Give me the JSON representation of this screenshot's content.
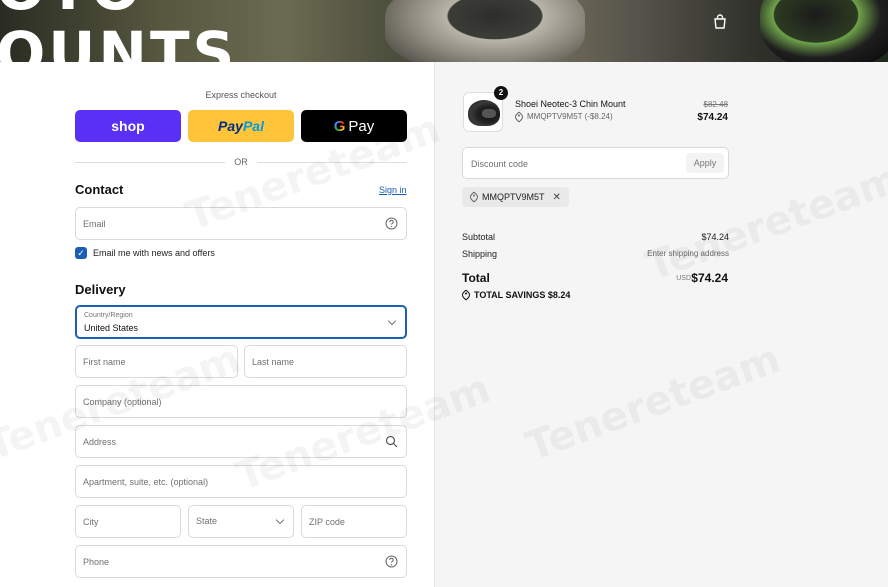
{
  "header": {
    "brand_line1": "OTO",
    "brand_line2": "OUNTS"
  },
  "express": {
    "label": "Express checkout",
    "shop_label": "shop",
    "paypal_part1": "Pay",
    "paypal_part2": "Pal",
    "gpay_g": "G",
    "gpay_label": "Pay",
    "or_label": "OR"
  },
  "contact": {
    "title": "Contact",
    "sign_in": "Sign in",
    "email_placeholder": "Email",
    "newsletter_label": "Email me with news and offers",
    "newsletter_checked": true
  },
  "delivery": {
    "title": "Delivery",
    "country_label": "Country/Region",
    "country_value": "United States",
    "first_name_placeholder": "First name",
    "last_name_placeholder": "Last name",
    "company_placeholder": "Company (optional)",
    "address_placeholder": "Address",
    "apartment_placeholder": "Apartment, suite, etc. (optional)",
    "city_placeholder": "City",
    "state_placeholder": "State",
    "zip_placeholder": "ZIP code",
    "phone_placeholder": "Phone"
  },
  "order": {
    "item": {
      "name": "Shoei Neotec-3 Chin Mount",
      "quantity": "2",
      "discount_line": "MMQPTV9M5T (-$8.24)",
      "old_price": "$82.48",
      "new_price": "$74.24"
    },
    "discount_placeholder": "Discount code",
    "apply_label": "Apply",
    "applied_code": "MMQPTV9M5T",
    "subtotal_label": "Subtotal",
    "subtotal_value": "$74.24",
    "shipping_label": "Shipping",
    "shipping_value": "Enter shipping address",
    "total_label": "Total",
    "total_currency": "USD",
    "total_value": "$74.24",
    "savings_label": "TOTAL SAVINGS",
    "savings_value": "$8.24"
  },
  "watermark": "Tenereteam",
  "colors": {
    "shop_purple": "#5a31f4",
    "paypal_yellow": "#ffc439",
    "link_blue": "#1a5fb4"
  }
}
